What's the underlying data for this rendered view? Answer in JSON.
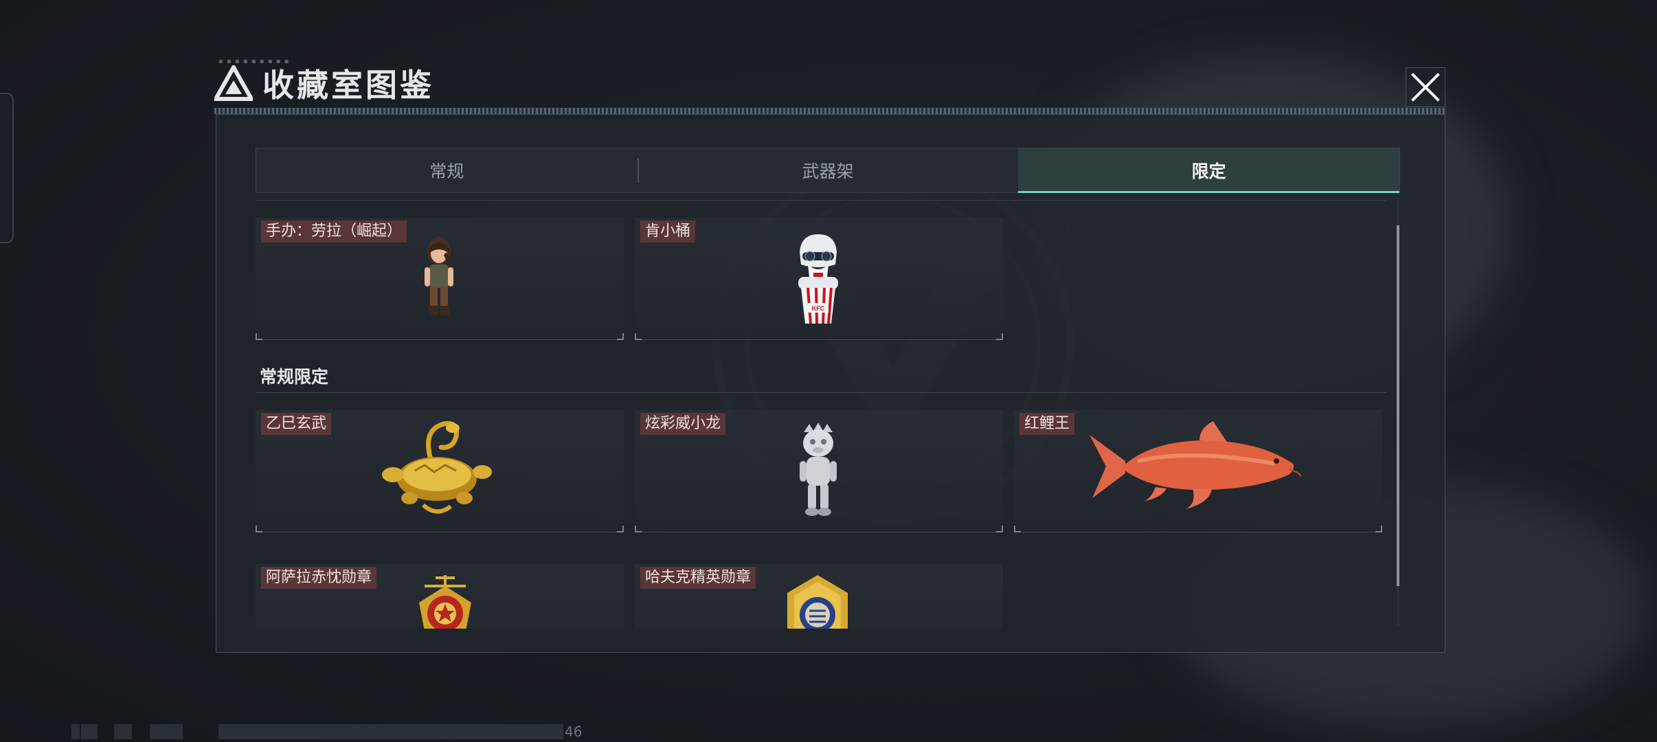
{
  "header": {
    "title": "收藏室图鉴",
    "close_label": "×"
  },
  "tabs": [
    {
      "label": "常规",
      "active": false
    },
    {
      "label": "武器架",
      "active": false
    },
    {
      "label": "限定",
      "active": true
    }
  ],
  "items_top": [
    {
      "label": "手办：劳拉（崛起）",
      "icon": "lara-figure-icon"
    },
    {
      "label": "肯小桶",
      "icon": "kfc-bucket-figure-icon"
    }
  ],
  "section": {
    "title": "常规限定"
  },
  "items_section": [
    {
      "label": "乙巳玄武",
      "icon": "golden-turtle-snake-icon"
    },
    {
      "label": "炫彩威小龙",
      "icon": "silver-dragon-figure-icon"
    },
    {
      "label": "红鲤王",
      "icon": "red-carp-icon"
    },
    {
      "label": "阿萨拉赤忱勋章",
      "icon": "asala-medal-icon"
    },
    {
      "label": "哈夫克精英勋章",
      "icon": "haavk-elite-medal-icon"
    }
  ],
  "footer": {
    "counter": "46"
  },
  "colors": {
    "accent": "#6fd6b6",
    "label_bg": "#5a3638",
    "panel_bg": "#21262c"
  }
}
